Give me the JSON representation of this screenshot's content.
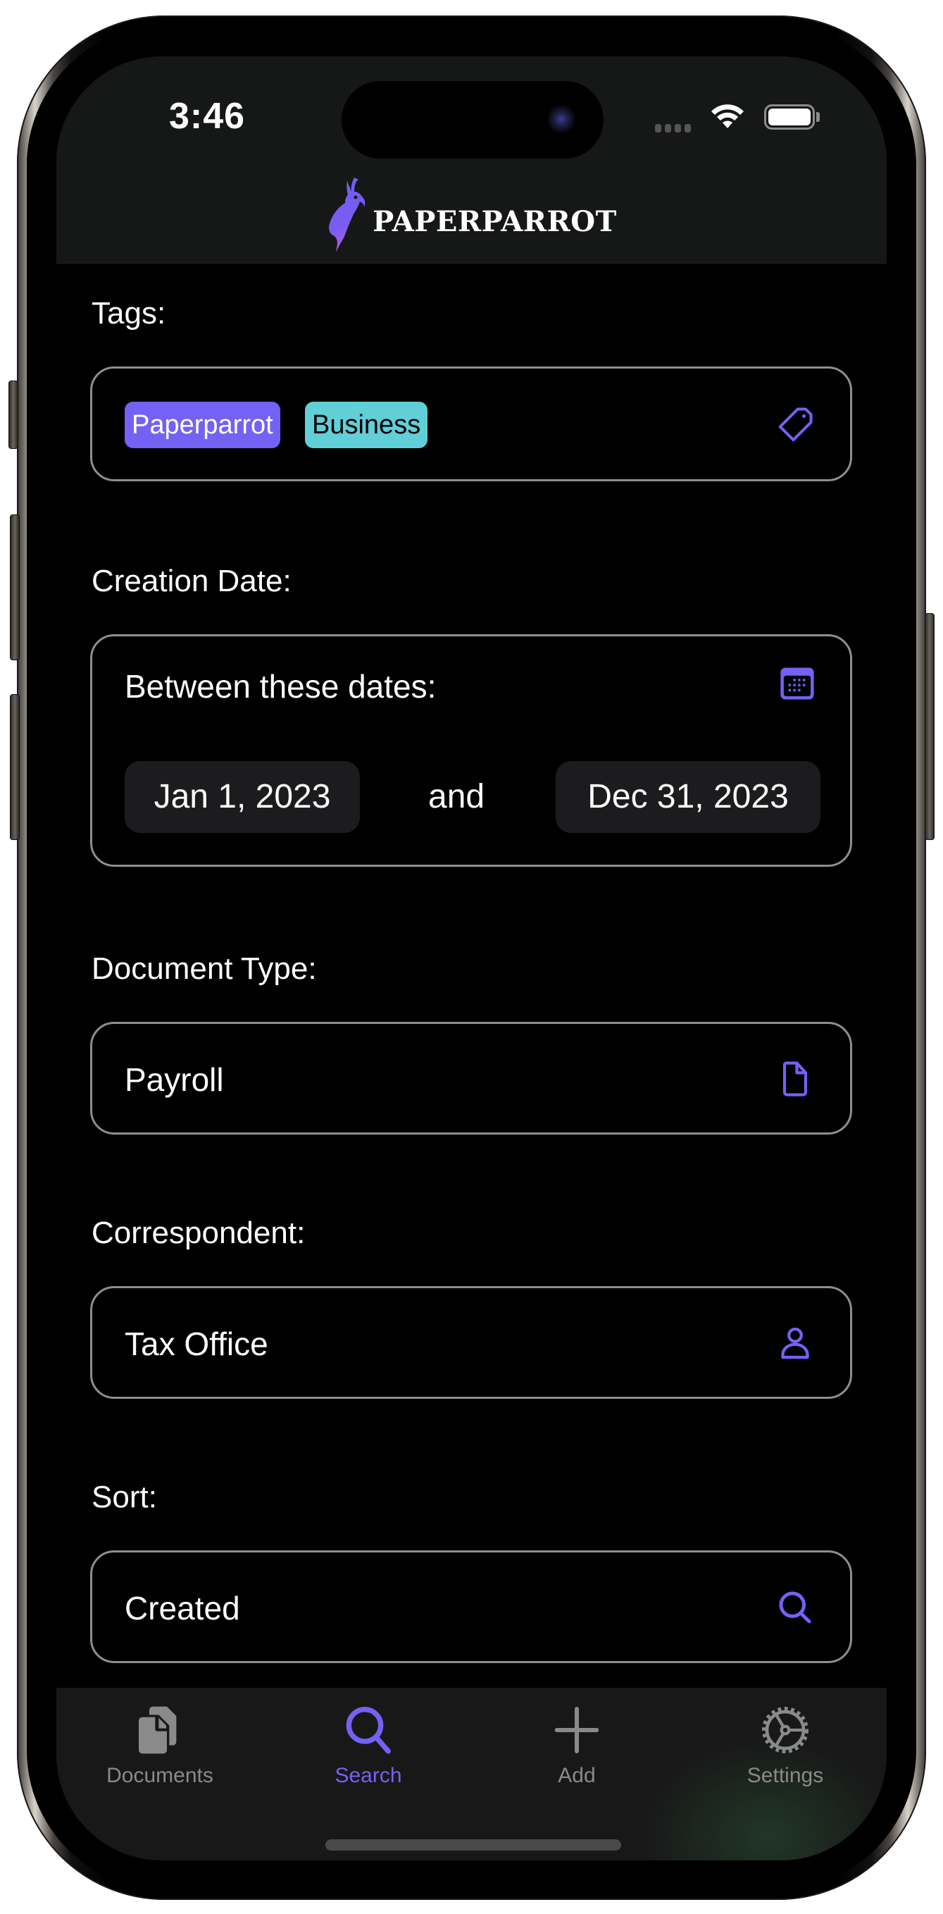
{
  "status_bar": {
    "time": "3:46"
  },
  "header": {
    "app_name": "PAPERPARROT",
    "logo_icon": "parrot-logo-icon"
  },
  "colors": {
    "accent": "#7362f4",
    "tag_paperparrot_bg": "#7362f4",
    "tag_business_bg": "#60cfd8",
    "field_border": "#8e8e8e",
    "tab_inactive": "#8a8a8a"
  },
  "filters": {
    "tags": {
      "label": "Tags:",
      "items": [
        {
          "name": "Paperparrot",
          "bg": "#7362f4",
          "fg": "#ffffff"
        },
        {
          "name": "Business",
          "bg": "#60cfd8",
          "fg": "#000000"
        }
      ],
      "icon": "tag-icon"
    },
    "creation_date": {
      "label": "Creation Date:",
      "mode": "Between these dates:",
      "icon": "calendar-icon",
      "start": "Jan 1, 2023",
      "conjunction": "and",
      "end": "Dec 31, 2023"
    },
    "document_type": {
      "label": "Document Type:",
      "value": "Payroll",
      "icon": "document-icon"
    },
    "correspondent": {
      "label": "Correspondent:",
      "value": "Tax Office",
      "icon": "person-icon"
    },
    "sort": {
      "label": "Sort:",
      "value": "Created",
      "icon": "search-icon"
    }
  },
  "tabbar": {
    "items": [
      {
        "label": "Documents",
        "icon": "documents-icon",
        "active": false
      },
      {
        "label": "Search",
        "icon": "search-icon",
        "active": true
      },
      {
        "label": "Add",
        "icon": "plus-icon",
        "active": false
      },
      {
        "label": "Settings",
        "icon": "gear-icon",
        "active": false
      }
    ]
  }
}
